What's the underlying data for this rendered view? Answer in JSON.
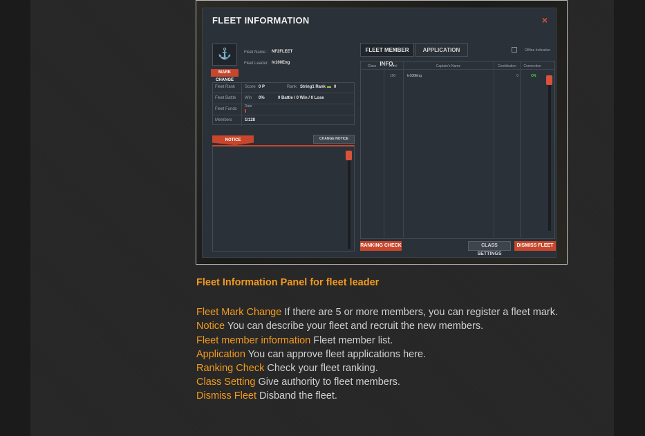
{
  "screenshot": {
    "window_title": "FLEET INFORMATION",
    "close_glyph": "×",
    "mark_change_label": "MARK CHANGE",
    "fleet_name_label": "Fleet Name",
    "fleet_name_sep": ":",
    "fleet_name_value": "NF2FLEET",
    "fleet_leader_label": "Fleet Leader",
    "fleet_leader_sep": ":",
    "fleet_leader_value": "lv100Eng",
    "stats": {
      "rank_label": "Fleet Rank",
      "score_label": "Score",
      "score_value": "0 P",
      "rank_sub_label": "Rank",
      "rank_value": "String1 Rank",
      "rank_change": "0",
      "battle_label": "Fleet Battle",
      "win_label": "Win",
      "win_value": "0%",
      "battle_record": "0 Battle / 0 Win / 0 Lose",
      "funds_label": "Fleet Funds",
      "funds_value": "Rate",
      "members_label": "Members",
      "members_value": "1/128"
    },
    "notice_tab": "NOTICE",
    "change_notice_button": "CHANGE NOTICE",
    "tabs": [
      "FLEET MEMBER INFO.",
      "APPLICATION"
    ],
    "offline_indication": "Offline Indication",
    "columns": [
      "Class",
      "Level",
      "Captain's Name",
      "Contribution",
      "Connection"
    ],
    "rows": [
      {
        "class": "",
        "level": "100",
        "name": "lv100Eng",
        "contribution": "0",
        "connection": "ON"
      }
    ],
    "ranking_check_button": "RANKING CHECK",
    "class_settings_button": "CLASS SETTINGS",
    "dismiss_fleet_button": "DISMISS FLEET"
  },
  "caption": {
    "heading": "Fleet Information Panel for fleet leader",
    "items": [
      {
        "term": "Fleet Mark Change",
        "desc": " If there are 5 or more members, you can register a fleet mark."
      },
      {
        "term": "Notice",
        "desc": " You can describe your fleet and recruit the new members."
      },
      {
        "term": "Fleet member information",
        "desc": " Fleet member list."
      },
      {
        "term": "Application",
        "desc": " You can approve fleet applications here."
      },
      {
        "term": "Ranking Check",
        "desc": " Check your fleet ranking."
      },
      {
        "term": "Class Setting",
        "desc": " Give authority to fleet members."
      },
      {
        "term": "Dismiss Fleet",
        "desc": " Disband the fleet."
      }
    ]
  },
  "colors": {
    "accent_orange": "#f39a1e",
    "game_red": "#c8462c",
    "online_green": "#3fd13f"
  }
}
